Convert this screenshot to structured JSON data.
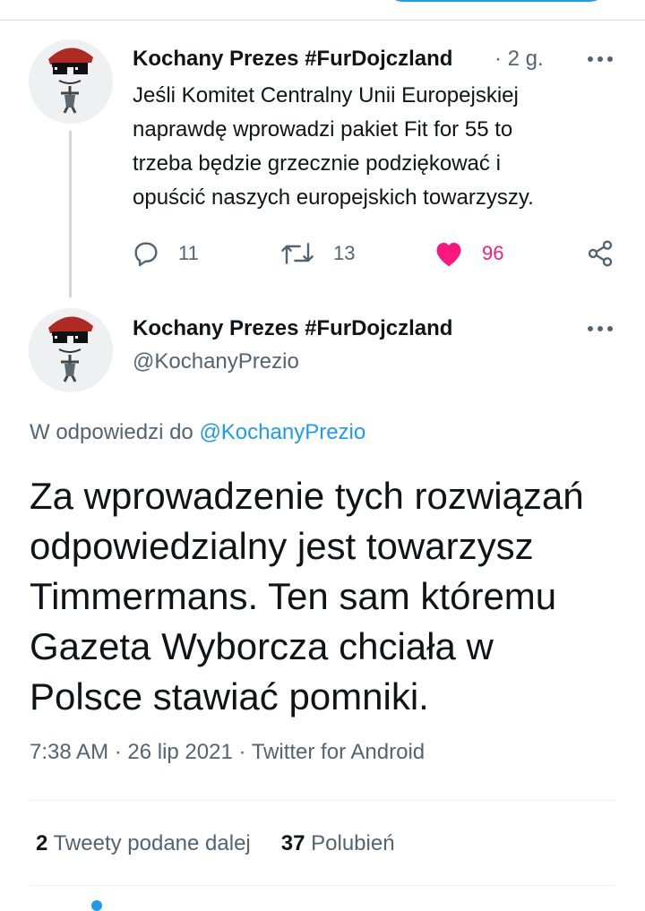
{
  "colors": {
    "accent": "#1d9bf0",
    "like": "#f91880",
    "muted": "#536471",
    "text": "#0f1419"
  },
  "icons": [
    "avatar-image",
    "reply-icon",
    "retweet-icon",
    "heart-icon",
    "share-icon",
    "more-icon"
  ],
  "parent_tweet": {
    "author_name": "Kochany Prezes #FurDojczland",
    "time": "· 2 g.",
    "text_lines": [
      "Jeśli Komitet Centralny Unii Europejskiej",
      "naprawdę wprowadzi pakiet Fit for 55 to",
      "trzeba będzie grzecznie podziękować i",
      "opuścić naszych europejskich towarzyszy."
    ],
    "replies": "11",
    "retweets": "13",
    "likes": "96"
  },
  "main_tweet": {
    "author_name": "Kochany Prezes #FurDojczland",
    "handle": "@KochanyPrezio",
    "reply_prefix": "W odpowiedzi do ",
    "reply_mention": "@KochanyPrezio",
    "text_lines": [
      "Za wprowadzenie tych rozwiązań",
      "odpowiedzialny jest towarzysz",
      "Timmermans. Ten sam któremu",
      "Gazeta Wyborcza chciała w",
      "Polsce stawiać pomniki."
    ],
    "meta": "7:38 AM · 26 lip 2021 · Twitter for Android",
    "retweet_count": "2",
    "retweet_label": " Tweety podane dalej",
    "like_count": "37",
    "like_label": " Polubień"
  }
}
